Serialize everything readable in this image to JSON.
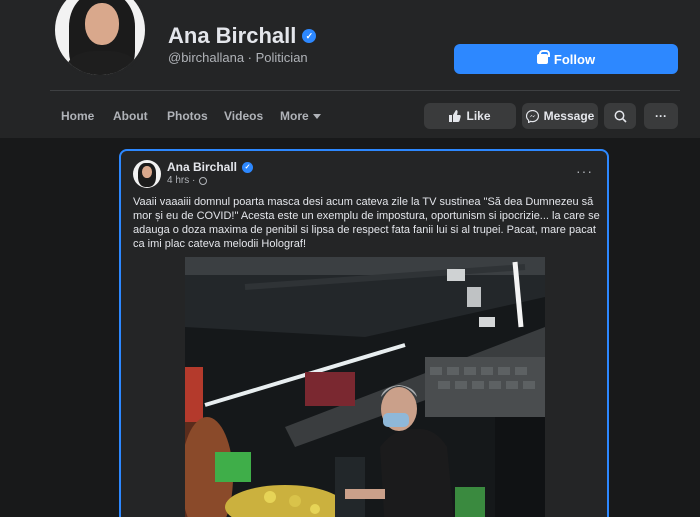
{
  "profile": {
    "name": "Ana Birchall",
    "handle": "@birchallana",
    "category": "Politician",
    "subtitle": "@birchallana · Politician",
    "follow_label": "Follow"
  },
  "nav": {
    "tabs": [
      {
        "label": "Home"
      },
      {
        "label": "About"
      },
      {
        "label": "Photos"
      },
      {
        "label": "Videos"
      },
      {
        "label": "More"
      }
    ],
    "like_label": "Like",
    "message_label": "Message",
    "more_dots": "···"
  },
  "post": {
    "author": "Ana Birchall",
    "time": "4 hrs ·",
    "more_dots": "···",
    "text": "Vaaii vaaaiii domnul poarta masca desi acum cateva zile la TV sustinea \"Să dea Dumnezeu să mor și eu de COVID!\" Acesta este un exemplu de impostura, oportunism si ipocrizie... la care se adauga o doza maxima de penibil si lipsa de respect fata fanii lui si al trupei. Pacat, mare pacat ca imi plac cateva melodii Holograf!"
  },
  "colors": {
    "background": "#18191a",
    "card": "#242526",
    "accent": "#2d88ff",
    "button_gray": "#3a3b3c",
    "text_primary": "#e4e6eb",
    "text_secondary": "#b0b3b8"
  },
  "icons": [
    "verified-badge-icon",
    "lock-icon",
    "like-icon",
    "messenger-icon",
    "search-icon",
    "globe-icon",
    "more-dots-icon"
  ]
}
